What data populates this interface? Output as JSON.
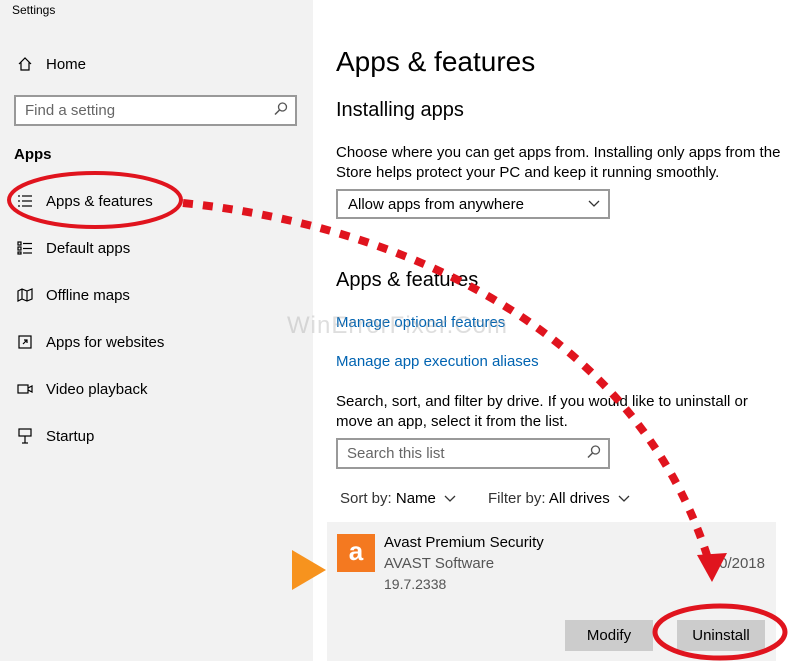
{
  "window": {
    "title": "Settings"
  },
  "sidebar": {
    "home_label": "Home",
    "search_placeholder": "Find a setting",
    "section_label": "Apps",
    "items": [
      {
        "label": "Apps & features",
        "icon": "list-icon"
      },
      {
        "label": "Default apps",
        "icon": "default-apps-icon"
      },
      {
        "label": "Offline maps",
        "icon": "map-icon"
      },
      {
        "label": "Apps for websites",
        "icon": "open-in-app-icon"
      },
      {
        "label": "Video playback",
        "icon": "video-icon"
      },
      {
        "label": "Startup",
        "icon": "startup-icon"
      }
    ]
  },
  "main": {
    "title": "Apps & features",
    "installing": {
      "heading": "Installing apps",
      "description": "Choose where you can get apps from. Installing only apps from the Store helps protect your PC and keep it running smoothly.",
      "dropdown_value": "Allow apps from anywhere"
    },
    "apps_features": {
      "heading": "Apps & features",
      "link_optional": "Manage optional features",
      "link_aliases": "Manage app execution aliases",
      "description": "Search, sort, and filter by drive. If you would like to uninstall or move an app, select it from the list.",
      "search_placeholder": "Search this list",
      "sort_label": "Sort by:",
      "sort_value": "Name",
      "filter_label": "Filter by:",
      "filter_value": "All drives"
    },
    "app": {
      "name": "Avast Premium Security",
      "publisher": "AVAST Software",
      "version": "19.7.2338",
      "date": "0/2018",
      "icon_letter": "a",
      "modify_label": "Modify",
      "uninstall_label": "Uninstall"
    }
  },
  "watermark": "WinErrorFixer.Com",
  "colors": {
    "accent_link": "#0063b1",
    "annotation_red": "#e0141e",
    "avast_orange": "#f47920",
    "pointer_orange": "#f7931e"
  }
}
